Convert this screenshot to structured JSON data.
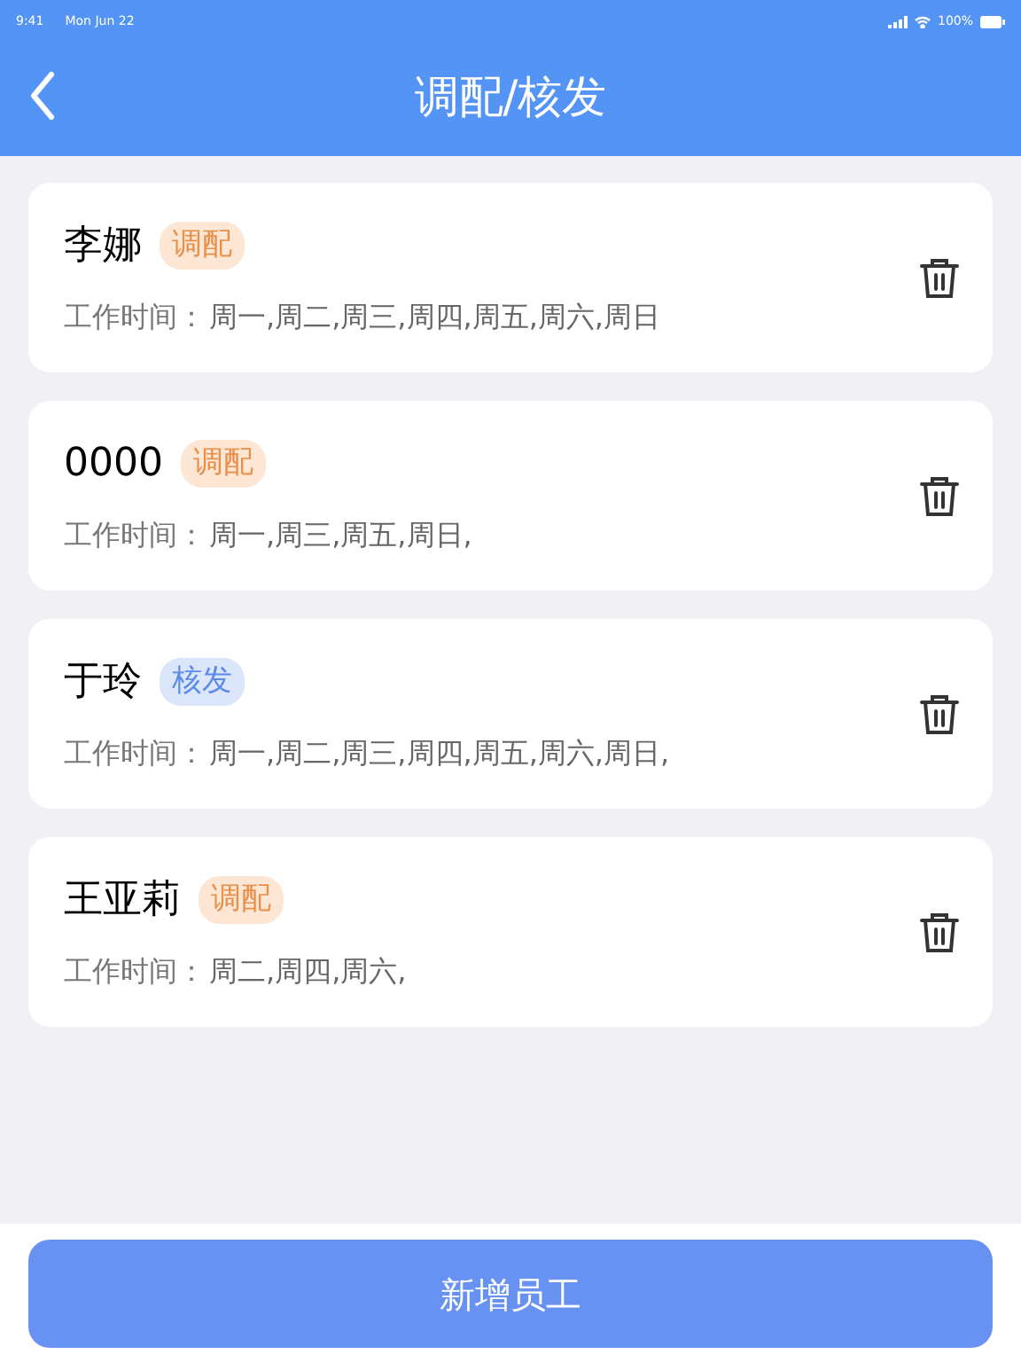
{
  "status_bar": {
    "time": "9:41",
    "date": "Mon Jun 22",
    "battery": "100%"
  },
  "header": {
    "title": "调配/核发"
  },
  "employees": [
    {
      "name": "李娜",
      "tag": {
        "label": "调配",
        "kind": "adjust"
      },
      "work_label": "工作时间：",
      "days": "周一,周二,周三,周四,周五,周六,周日"
    },
    {
      "name": "0000",
      "tag": {
        "label": "调配",
        "kind": "adjust"
      },
      "work_label": "工作时间：",
      "days": "周一,周三,周五,周日,"
    },
    {
      "name": "于玲",
      "tag": {
        "label": "核发",
        "kind": "issue"
      },
      "work_label": "工作时间：",
      "days": "周一,周二,周三,周四,周五,周六,周日,"
    },
    {
      "name": "王亚莉",
      "tag": {
        "label": "调配",
        "kind": "adjust"
      },
      "work_label": "工作时间：",
      "days": "周二,周四,周六,"
    }
  ],
  "add_button": "新增员工"
}
